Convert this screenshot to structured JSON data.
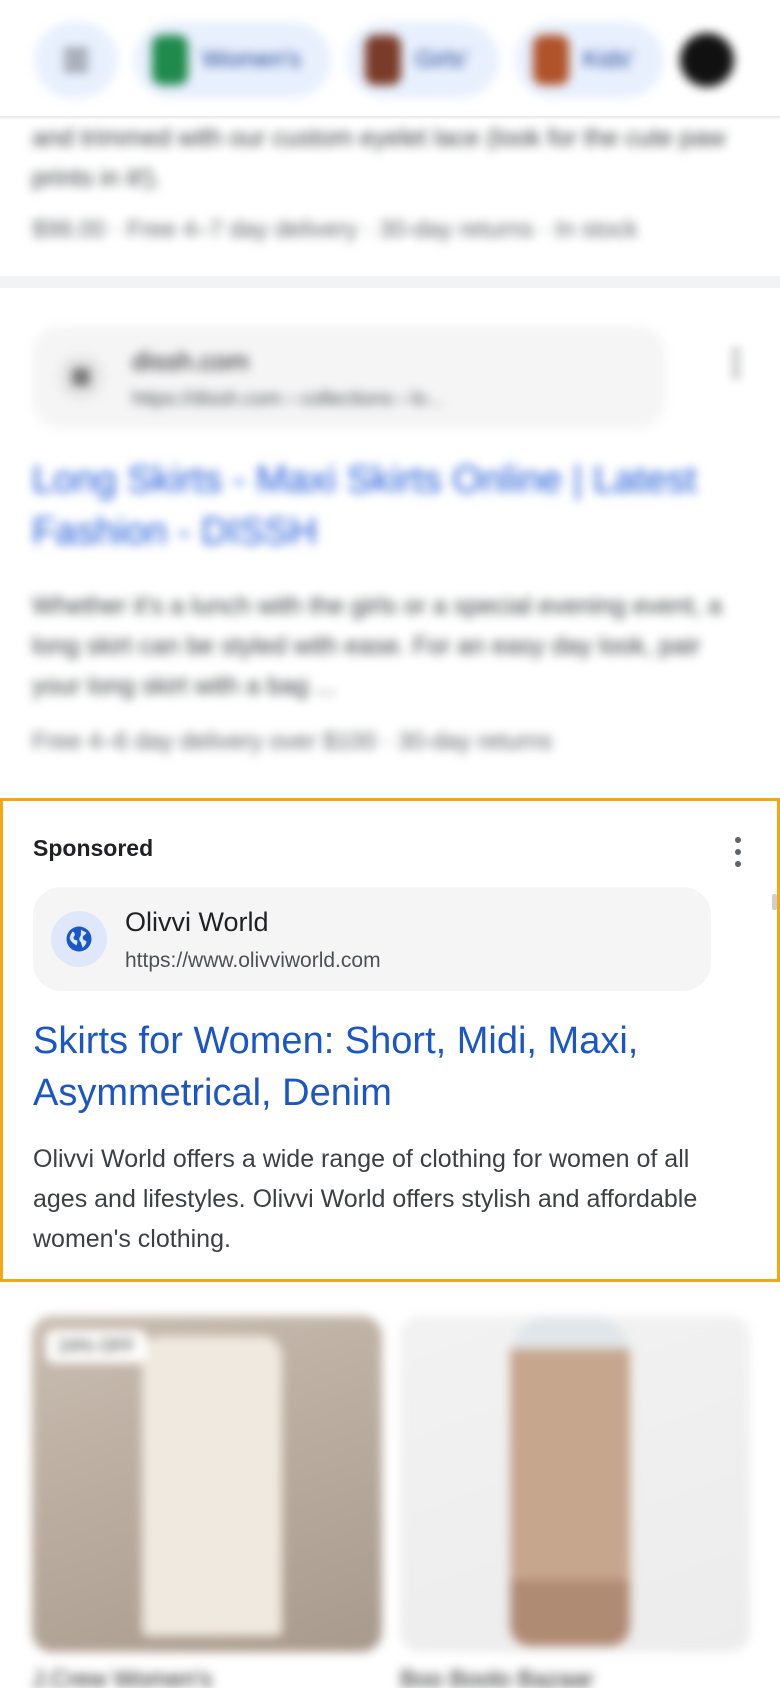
{
  "chips": [
    {
      "label": "Women's",
      "thumb_color": "#1f8a4c"
    },
    {
      "label": "Girls'",
      "thumb_color": "#7a3b28"
    },
    {
      "label": "Kids'",
      "thumb_color": "#b0522a"
    }
  ],
  "previous_result": {
    "snippet": "and trimmed with our custom eyelet lace (look for the cute paw prints in it!).",
    "meta": "$98.00 · Free 4–7 day delivery · 30-day returns · In stock"
  },
  "result_dissh": {
    "site_name": "dissh.com",
    "url": "https://dissh.com › collections › lo...",
    "title": "Long Skirts - Maxi Skirts Online | Latest Fashion - DISSH",
    "snippet": "Whether it's a lunch with the girls or a special evening event, a long skirt can be styled with ease. For an easy day look, pair your long skirt with a bag ...",
    "meta": "Free 4–6 day delivery over $100 · 30-day returns"
  },
  "ad": {
    "label": "Sponsored",
    "advertiser": "Olivvi World",
    "url": "https://www.olivviworld.com",
    "title": "Skirts for Women: Short, Midi, Maxi, Asymmetrical, Denim",
    "description": "Olivvi World offers a wide range of clothing for women of all ages and lifestyles. Olivvi World offers stylish and affordable women's clothing.",
    "highlight_color": "#f3a712",
    "link_color": "#1a56c6"
  },
  "products": [
    {
      "badge": "24% OFF",
      "name": "J.Crew Women's"
    },
    {
      "name": "Boo Boolo Bazaar"
    }
  ]
}
